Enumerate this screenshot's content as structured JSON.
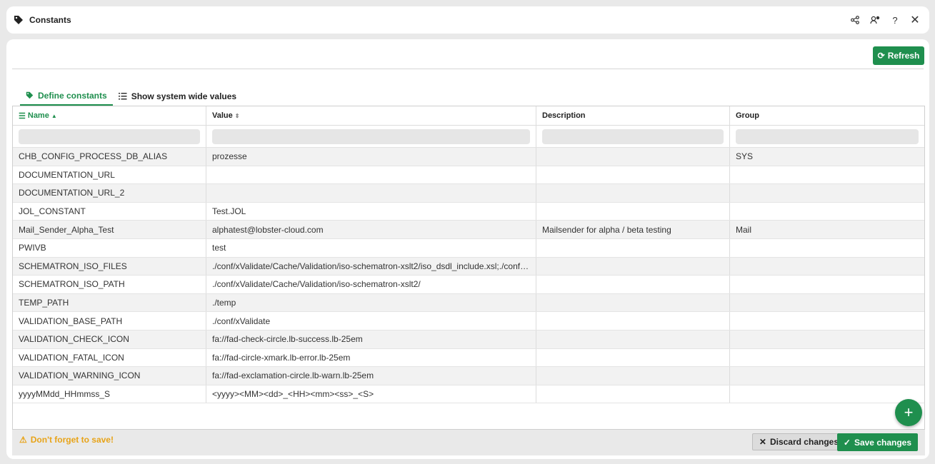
{
  "window": {
    "title": "Constants",
    "icons": [
      "share-icon",
      "user-settings-icon",
      "help-icon",
      "close-icon"
    ]
  },
  "toolbar": {
    "refresh_label": "Refresh"
  },
  "tabs": [
    {
      "label": "Define constants",
      "icon": "tag-icon",
      "active": true
    },
    {
      "label": "Show system wide values",
      "icon": "list-icon",
      "active": false
    }
  ],
  "table": {
    "columns": [
      "Name",
      "Value",
      "Description",
      "Group"
    ],
    "rows": [
      [
        "CHB_CONFIG_PROCESS_DB_ALIAS",
        "prozesse",
        "",
        "SYS"
      ],
      [
        "DOCUMENTATION_URL",
        "",
        "",
        ""
      ],
      [
        "DOCUMENTATION_URL_2",
        "",
        "",
        ""
      ],
      [
        "JOL_CONSTANT",
        "Test.JOL",
        "",
        ""
      ],
      [
        "Mail_Sender_Alpha_Test",
        "alphatest@lobster-cloud.com",
        "Mailsender for alpha / beta testing",
        "Mail"
      ],
      [
        "PWIVB",
        "test",
        "",
        ""
      ],
      [
        "SCHEMATRON_ISO_FILES",
        "./conf/xValidate/Cache/Validation/iso-schematron-xslt2/iso_dsdl_include.xsl;./conf…",
        "",
        ""
      ],
      [
        "SCHEMATRON_ISO_PATH",
        "./conf/xValidate/Cache/Validation/iso-schematron-xslt2/",
        "",
        ""
      ],
      [
        "TEMP_PATH",
        "./temp",
        "",
        ""
      ],
      [
        "VALIDATION_BASE_PATH",
        "./conf/xValidate",
        "",
        ""
      ],
      [
        "VALIDATION_CHECK_ICON",
        "fa://fad-check-circle.lb-success.lb-25em",
        "",
        ""
      ],
      [
        "VALIDATION_FATAL_ICON",
        "fa://fad-circle-xmark.lb-error.lb-25em",
        "",
        ""
      ],
      [
        "VALIDATION_WARNING_ICON",
        "fa://fad-exclamation-circle.lb-warn.lb-25em",
        "",
        ""
      ],
      [
        "yyyyMMdd_HHmmss_S",
        "<yyyy><MM><dd>_<HH><mm><ss>_<S>",
        "",
        ""
      ]
    ]
  },
  "footer": {
    "warning": "Don't forget to save!",
    "discard_label": "Discard changes",
    "save_label": "Save changes"
  },
  "colors": {
    "accent": "#1f8f4e",
    "warning": "#e8a317"
  }
}
